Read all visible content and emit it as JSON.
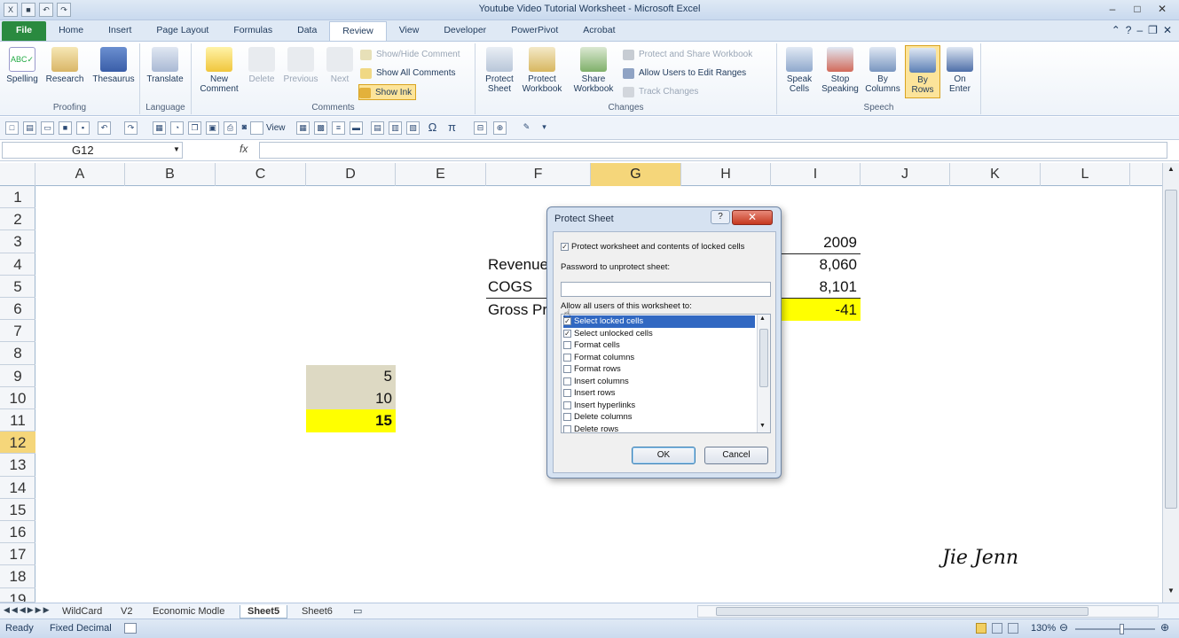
{
  "window": {
    "title": "Youtube Video Tutorial Worksheet - Microsoft Excel"
  },
  "tabs": [
    "File",
    "Home",
    "Insert",
    "Page Layout",
    "Formulas",
    "Data",
    "Review",
    "View",
    "Developer",
    "PowerPivot",
    "Acrobat"
  ],
  "active_tab": "Review",
  "ribbon": {
    "proofing": {
      "spelling": "Spelling",
      "research": "Research",
      "thesaurus": "Thesaurus",
      "label": "Proofing"
    },
    "language": {
      "translate": "Translate",
      "label": "Language"
    },
    "comments": {
      "new_comment_1": "New",
      "new_comment_2": "Comment",
      "delete": "Delete",
      "previous": "Previous",
      "next": "Next",
      "show_hide": "Show/Hide Comment",
      "show_all": "Show All Comments",
      "show_ink": "Show Ink",
      "label": "Comments"
    },
    "changes": {
      "protect_sheet_1": "Protect",
      "protect_sheet_2": "Sheet",
      "protect_wb_1": "Protect",
      "protect_wb_2": "Workbook",
      "share_wb_1": "Share",
      "share_wb_2": "Workbook",
      "protect_share": "Protect and Share Workbook",
      "allow_users": "Allow Users to Edit Ranges",
      "track_changes": "Track Changes",
      "label": "Changes"
    },
    "speech": {
      "speak_cells_1": "Speak",
      "speak_cells_2": "Cells",
      "stop_speaking_1": "Stop",
      "stop_speaking_2": "Speaking",
      "by_columns_1": "By",
      "by_columns_2": "Columns",
      "by_rows_1": "By",
      "by_rows_2": "Rows",
      "on_enter_1": "On",
      "on_enter_2": "Enter",
      "label": "Speech"
    }
  },
  "toolbar": {
    "view_label": "View"
  },
  "formula_bar": {
    "name_box": "G12",
    "fx": "fx",
    "formula": ""
  },
  "columns": [
    "A",
    "B",
    "C",
    "D",
    "E",
    "F",
    "G",
    "H",
    "I",
    "J",
    "K",
    "L"
  ],
  "selected_column": "G",
  "rows": [
    "1",
    "2",
    "3",
    "4",
    "5",
    "6",
    "7",
    "8",
    "9",
    "10",
    "11",
    "12",
    "13",
    "14",
    "15",
    "16",
    "17",
    "18",
    "19"
  ],
  "selected_row": "12",
  "cells": {
    "i3": "2009",
    "f4": "Revenue",
    "i4": "8,060",
    "f5": "COGS",
    "i5": "8,101",
    "f6": "Gross Profit",
    "i6": "-41",
    "d9": "5",
    "d10": "10",
    "d11": "15"
  },
  "dialog": {
    "title": "Protect Sheet",
    "help": "?",
    "close": "✕",
    "protect_label": "Protect worksheet and contents of locked cells",
    "password_label": "Password to unprotect sheet:",
    "allow_label": "Allow all users of this worksheet to:",
    "options": [
      {
        "label": "Select locked cells",
        "checked": true,
        "selected": true
      },
      {
        "label": "Select unlocked cells",
        "checked": true,
        "selected": false
      },
      {
        "label": "Format cells",
        "checked": false,
        "selected": false
      },
      {
        "label": "Format columns",
        "checked": false,
        "selected": false
      },
      {
        "label": "Format rows",
        "checked": false,
        "selected": false
      },
      {
        "label": "Insert columns",
        "checked": false,
        "selected": false
      },
      {
        "label": "Insert rows",
        "checked": false,
        "selected": false
      },
      {
        "label": "Insert hyperlinks",
        "checked": false,
        "selected": false
      },
      {
        "label": "Delete columns",
        "checked": false,
        "selected": false
      },
      {
        "label": "Delete rows",
        "checked": false,
        "selected": false
      }
    ],
    "ok": "OK",
    "cancel": "Cancel"
  },
  "sheets": [
    "WildCard",
    "V2",
    "Economic Modle",
    "Sheet5",
    "Sheet6"
  ],
  "active_sheet": "Sheet5",
  "status": {
    "ready": "Ready",
    "fixed_decimal": "Fixed Decimal",
    "zoom": "130%"
  },
  "signature": "Jie Jenn",
  "colors": {
    "yellow": "#ffff00",
    "tan": "#ddd9c3",
    "selection": "#f5d67a",
    "file_tab": "#2a8a3f"
  }
}
